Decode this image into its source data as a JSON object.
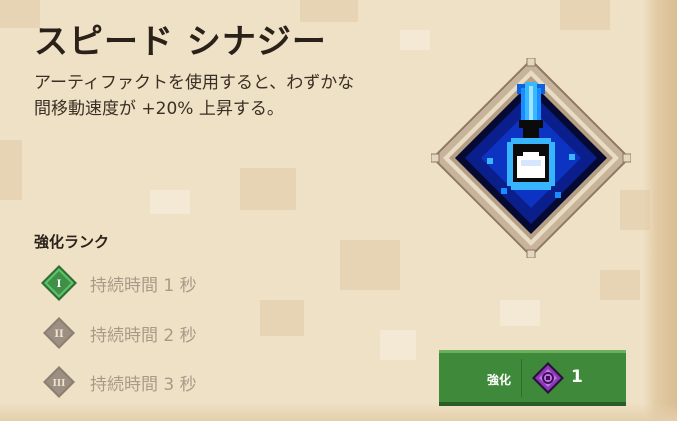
{
  "artifact": {
    "name": "スピード シナジー",
    "description_lines": [
      "アーティファクトを使用すると、わずかな",
      "間移動速度が +20% 上昇する。"
    ],
    "icon": "blue-potion-flask-icon"
  },
  "ranks": {
    "title": "強化ランク",
    "items": [
      {
        "numeral": "I",
        "label": "持続時間 1 秒",
        "unlocked": true
      },
      {
        "numeral": "II",
        "label": "持続時間 2 秒",
        "unlocked": false
      },
      {
        "numeral": "III",
        "label": "持続時間 3 秒",
        "unlocked": false
      }
    ]
  },
  "enchant_button": {
    "label": "強化",
    "cost": "1",
    "cost_icon": "enchantment-point-icon"
  },
  "colors": {
    "background": "#efe1c6",
    "active_rank": "#3f8f46",
    "locked_rank": "#8b7f72",
    "button": "#3f8a3a",
    "enchant_point": "#8c39b8"
  }
}
